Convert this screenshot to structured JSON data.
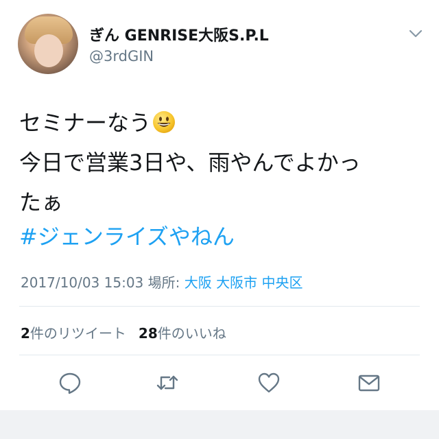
{
  "user": {
    "display_name": "ぎん GENRISE大阪S.P.L",
    "handle": "@3rdGIN"
  },
  "tweet": {
    "line1": "セミナーなう",
    "line2": "今日で営業3日や、雨やんでよかっ",
    "line3": "たぁ",
    "emoji": "grinning-face-emoji",
    "hashtag": "#ジェンライズやねん"
  },
  "meta": {
    "timestamp": "2017/10/03 15:03",
    "location_label": "場所:",
    "location": "大阪 大阪市 中央区"
  },
  "stats": {
    "retweet_count": "2",
    "retweet_label": "件のリツイート",
    "like_count": "28",
    "like_label": "件のいいね"
  },
  "icons": {
    "reply": "reply-icon",
    "retweet": "retweet-icon",
    "like": "heart-icon",
    "dm": "envelope-icon",
    "menu": "chevron-down-icon"
  },
  "colors": {
    "accent": "#1da1f2",
    "secondary_text": "#657786",
    "primary_text": "#14171a"
  }
}
